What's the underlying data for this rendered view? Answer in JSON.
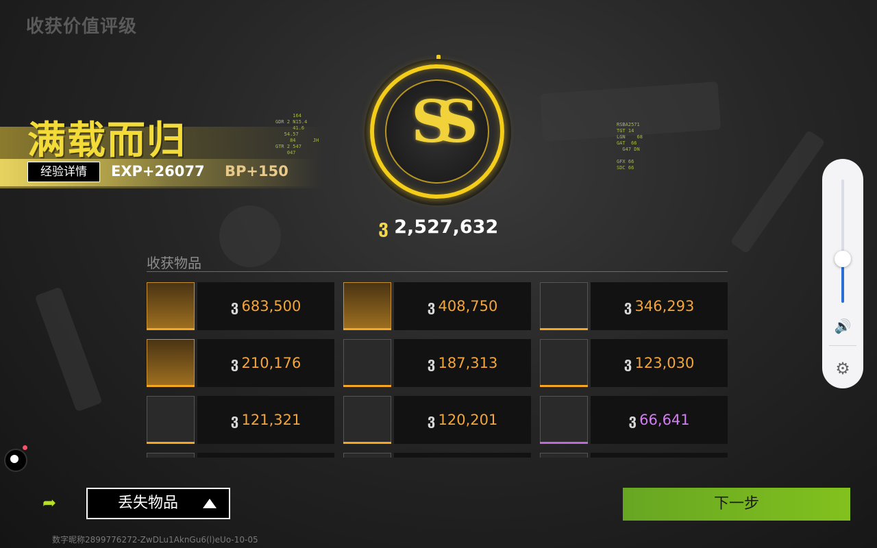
{
  "page": {
    "title": "收获价值评级"
  },
  "result": {
    "headline": "满载而归",
    "exp_details_label": "经验详情",
    "exp": "EXP+26077",
    "bp": "BP+150",
    "grade": "SS",
    "total_value": "2,527,632",
    "coin_symbol": "ვ"
  },
  "items_section": {
    "title": "收获物品",
    "items": [
      {
        "value": "683,500",
        "icon": "medal-icon",
        "rarity_color": "#f5a623"
      },
      {
        "value": "408,750",
        "icon": "wire-icon",
        "rarity_color": "#f5a623"
      },
      {
        "value": "346,293",
        "icon": "helmet-icon",
        "rarity_color": "#f5a623"
      },
      {
        "value": "210,176",
        "icon": "grenade-icon",
        "rarity_color": "#f5a623"
      },
      {
        "value": "187,313",
        "icon": "vest-icon",
        "rarity_color": "#f5a623"
      },
      {
        "value": "123,030",
        "icon": "thermometer-gun-icon",
        "rarity_color": "#f5a623"
      },
      {
        "value": "121,321",
        "icon": "card-icon",
        "rarity_color": "#f5a623"
      },
      {
        "value": "120,201",
        "icon": "gun-icon",
        "rarity_color": "#f5a623"
      },
      {
        "value": "66,641",
        "icon": "gold-chain-icon",
        "rarity_color": "#c06ad8"
      }
    ]
  },
  "bottom": {
    "lost_items_label": "丢失物品",
    "next_label": "下一步",
    "footer_text": "数字昵称2899776272-ZwDLu1AknGu6(l)eUo-10-05"
  },
  "volume_panel": {
    "level": 0.35,
    "speaker_icon": "speaker-icon",
    "settings_icon": "gear-icon"
  },
  "colors": {
    "accent_yellow": "#f3db3a",
    "value_orange": "#f4a53a",
    "value_purple": "#d27ef0",
    "next_green": "#7cbf1e"
  }
}
